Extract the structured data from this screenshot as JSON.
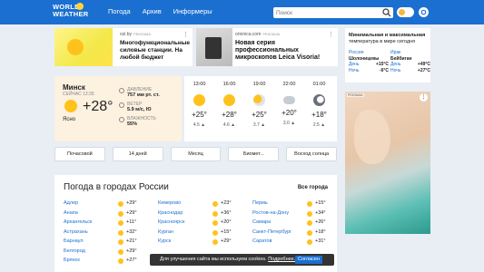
{
  "header": {
    "logo_line1": "WORLD",
    "logo_line2": "WEATHER",
    "nav": [
      "Погода",
      "Архив",
      "Информеры"
    ],
    "search_placeholder": "Поиск"
  },
  "ads": {
    "ad1_source": "ozi.by",
    "ad1_tag": "РЕКЛАМА",
    "ad1_title": "Многофункциональные силовые станции. На любой бюджет",
    "ad2_source": "orionica.com",
    "ad2_tag": "РЕКЛАМА",
    "ad2_title": "Новая серия профессиональных микроскопов Leica Visoria!"
  },
  "info": {
    "heading_bold": "Минимальная и максимальная",
    "heading_rest": "температура в мире сегодня",
    "left": {
      "country": "Россия",
      "city": "Шолоницевы",
      "day_label": "День",
      "day_val": "+15°C",
      "night_label": "Ночь",
      "night_val": "-6°C"
    },
    "right": {
      "country": "Ирак",
      "city": "Бейбиган",
      "day_label": "День",
      "day_val": "+49°C",
      "night_label": "Ночь",
      "night_val": "+27°C"
    }
  },
  "current": {
    "city": "Минск",
    "now": "СЕЙЧАС  13:35",
    "temp": "+28°",
    "desc": "Ясно",
    "pressure_label": "ДАВЛЕНИЕ",
    "pressure_val": "757 мм рт. ст.",
    "wind_label": "ВЕТЕР",
    "wind_val": "5.9 м/с, Ю",
    "humidity_label": "ВЛАЖНОСТЬ",
    "humidity_val": "55%"
  },
  "hourly": [
    {
      "time": "13:00",
      "temp": "+25°",
      "wind": "4.5",
      "icon": "sun-icon"
    },
    {
      "time": "16:00",
      "temp": "+28°",
      "wind": "4.6",
      "icon": "sun-icon"
    },
    {
      "time": "19:00",
      "temp": "+25°",
      "wind": "3.7",
      "icon": "partly-cloudy-icon"
    },
    {
      "time": "22:00",
      "temp": "+20°",
      "wind": "3.0",
      "icon": "cloud-icon"
    },
    {
      "time": "01:00",
      "temp": "+18°",
      "wind": "2.5",
      "icon": "moon-icon"
    }
  ],
  "buttons": [
    "Почасовой",
    "14 дней",
    "Месяц",
    "Биомет...",
    "Восход солнца"
  ],
  "cities": {
    "title": "Погода в городах России",
    "all": "Все города",
    "rows": [
      [
        [
          "Адлер",
          "+29°"
        ],
        [
          "Кемерово",
          "+23°"
        ],
        [
          "Пермь",
          "+15°"
        ]
      ],
      [
        [
          "Анапа",
          "+29°"
        ],
        [
          "Краснодар",
          "+36°"
        ],
        [
          "Ростов-на-Дону",
          "+34°"
        ]
      ],
      [
        [
          "Архангельск",
          "+11°"
        ],
        [
          "Красноярск",
          "+20°"
        ],
        [
          "Самара",
          "+26°"
        ]
      ],
      [
        [
          "Астрахань",
          "+32°"
        ],
        [
          "Курган",
          "+15°"
        ],
        [
          "Санкт-Петербург",
          "+18°"
        ]
      ],
      [
        [
          "Барнаул",
          "+21°"
        ],
        [
          "Курск",
          "+29°"
        ],
        [
          "Саратов",
          "+31°"
        ]
      ],
      [
        [
          "Белгород",
          "+29°"
        ],
        [
          "",
          ""
        ],
        [
          "",
          ""
        ]
      ],
      [
        [
          "Брянск",
          "+27°"
        ],
        [
          "",
          ""
        ],
        [
          "",
          ""
        ]
      ]
    ]
  },
  "bigad_tag": "РЕКЛАМА",
  "cookie": {
    "text": "Для улучшения сайта мы используем cookies.",
    "link": "Подробнее.",
    "ok": "Согласен"
  }
}
